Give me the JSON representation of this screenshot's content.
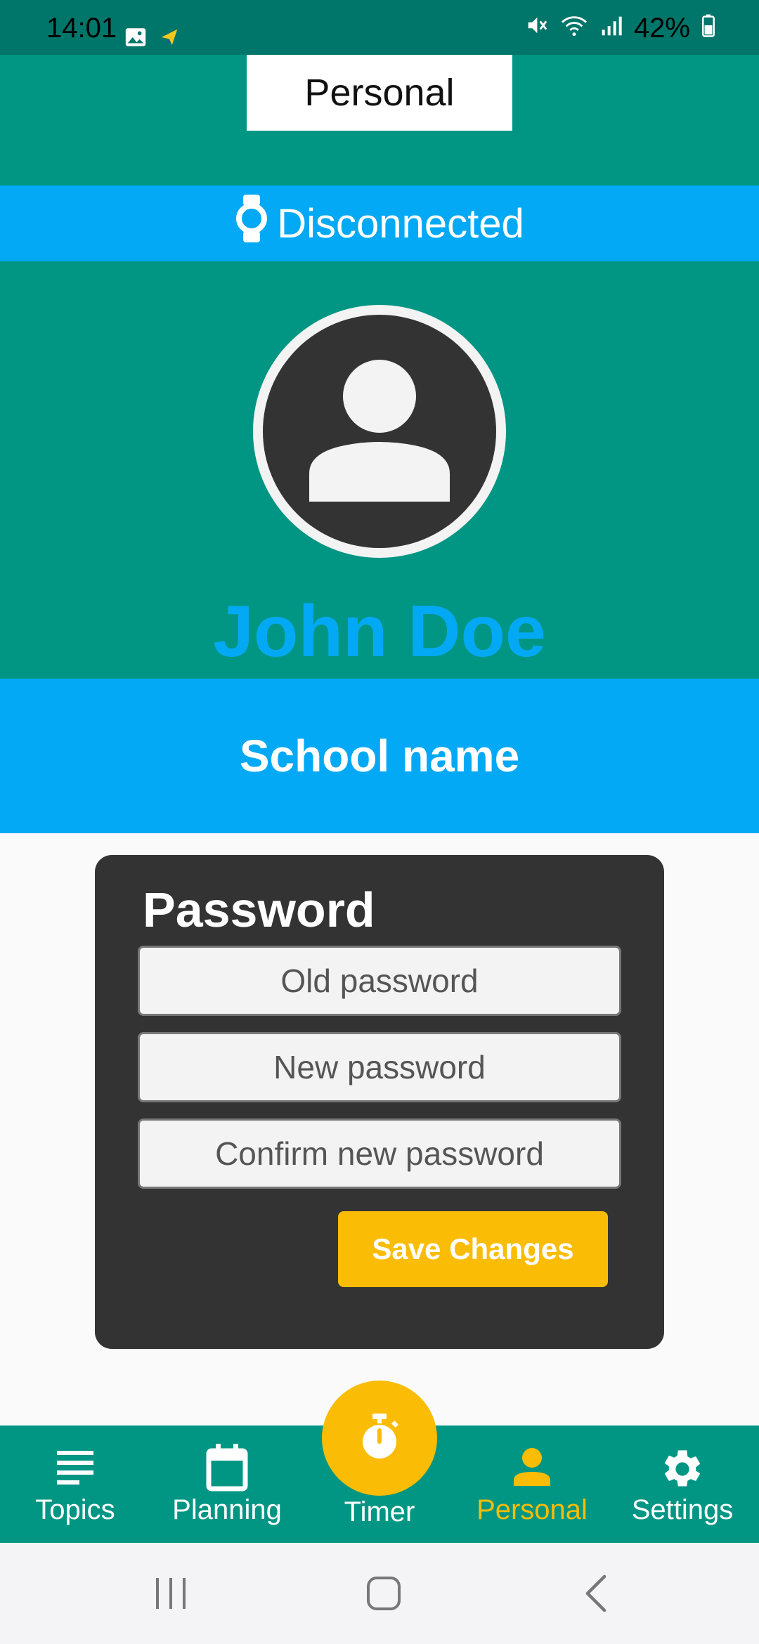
{
  "status_bar": {
    "time": "14:01",
    "battery": "42%"
  },
  "header": {
    "tab_label": "Personal"
  },
  "connection": {
    "status": "Disconnected"
  },
  "profile": {
    "name": "John Doe",
    "school": "School name"
  },
  "password_card": {
    "title": "Password",
    "old_placeholder": "Old password",
    "new_placeholder": "New password",
    "confirm_placeholder": "Confirm new password",
    "save_label": "Save Changes"
  },
  "bottom_nav": {
    "items": [
      {
        "label": "Topics",
        "icon": "topics-icon"
      },
      {
        "label": "Planning",
        "icon": "calendar-icon"
      },
      {
        "label": "Timer",
        "icon": "stopwatch-icon"
      },
      {
        "label": "Personal",
        "icon": "person-icon",
        "active": true
      },
      {
        "label": "Settings",
        "icon": "gear-icon"
      }
    ]
  },
  "colors": {
    "teal": "#009683",
    "blue": "#03a9f4",
    "yellow": "#fbbc05",
    "dark": "#333333"
  }
}
